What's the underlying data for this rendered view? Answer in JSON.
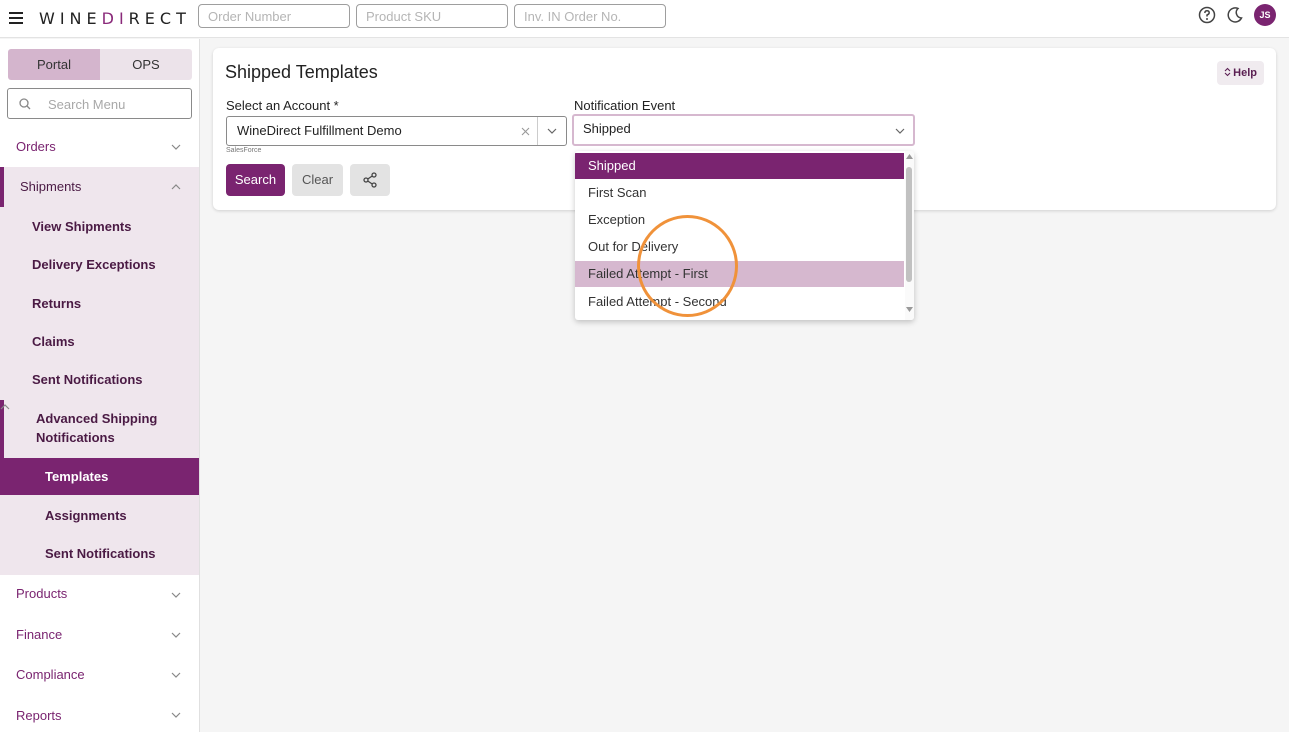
{
  "header": {
    "logo_prefix": "WINE",
    "logo_accent": "DI",
    "logo_suffix": "RECT",
    "order_number_placeholder": "Order Number",
    "product_sku_placeholder": "Product SKU",
    "inv_order_placeholder": "Inv. IN Order No.",
    "avatar_initials": "JS"
  },
  "sidebar": {
    "toggle": {
      "portal": "Portal",
      "ops": "OPS"
    },
    "search_placeholder": "Search Menu",
    "orders": "Orders",
    "shipments": "Shipments",
    "shipments_children": {
      "view_shipments": "View Shipments",
      "delivery_exceptions": "Delivery Exceptions",
      "returns": "Returns",
      "claims": "Claims",
      "sent_notifications": "Sent Notifications",
      "asn_line1": "Advanced Shipping",
      "asn_line2": "Notifications",
      "asn_children": {
        "templates": "Templates",
        "assignments": "Assignments",
        "sent_notifications": "Sent Notifications"
      }
    },
    "products": "Products",
    "finance": "Finance",
    "compliance": "Compliance",
    "reports": "Reports"
  },
  "main": {
    "title": "Shipped Templates",
    "help_label": "Help",
    "account_label": "Select an Account *",
    "account_value": "WineDirect Fulfillment Demo",
    "account_sub": "SalesForce",
    "event_label": "Notification Event",
    "event_value": "Shipped",
    "search_button": "Search",
    "clear_button": "Clear"
  },
  "dropdown": {
    "options": [
      "Shipped",
      "First Scan",
      "Exception",
      "Out for Delivery",
      "Failed Attempt - First",
      "Failed Attempt - Second"
    ],
    "selected_index": 0,
    "hover_index": 4
  },
  "colors": {
    "brand": "#7a2470",
    "brand_light": "#d6b8cf",
    "highlight": "#f0923a"
  }
}
